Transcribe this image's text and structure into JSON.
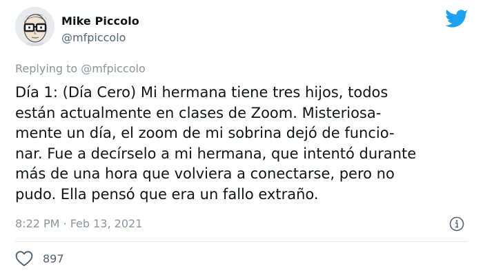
{
  "author": {
    "display_name": "Mike Piccolo",
    "handle": "@mfpiccolo"
  },
  "reply": {
    "text": "Replying to @mfpiccolo"
  },
  "tweet": {
    "lines": [
      "Día 1: (Día Cero) Mi hermana tiene tres hijos, todos",
      "están actualmente en clases de Zoom. Misteriosa-",
      "mente un día, el zoom de mi sobrina dejó de funcio-",
      "nar. Fue a decírselo a mi hermana, que intentó durante",
      "más de una hora que volviera a conectarse, pero no",
      "pudo. Ella pensó que era un fallo extraño."
    ]
  },
  "meta": {
    "time": "8:22 PM · Feb 13, 2021"
  },
  "engagement": {
    "likes": "897"
  },
  "icons": {
    "brand": "twitter-bird-icon",
    "info": "info-icon",
    "like": "heart-icon"
  },
  "colors": {
    "brand": "#1da1f2",
    "secondary_text": "#8a95a0",
    "text": "#0f1419"
  }
}
